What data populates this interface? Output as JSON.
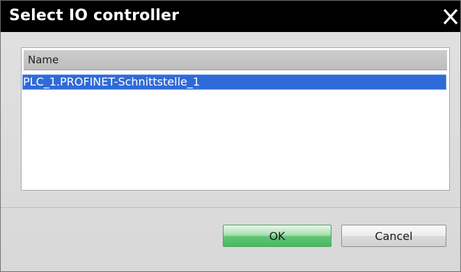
{
  "dialog": {
    "title": "Select IO controller",
    "close_icon": "close-icon"
  },
  "table": {
    "columns": [
      "Name"
    ],
    "rows": [
      {
        "name": "PLC_1.PROFINET-Schnittstelle_1",
        "selected": true
      }
    ]
  },
  "buttons": {
    "ok_label": "OK",
    "cancel_label": "Cancel"
  },
  "colors": {
    "titlebar": "#000000",
    "selection": "#2f6bd8",
    "ok_button": "#5ec474"
  }
}
